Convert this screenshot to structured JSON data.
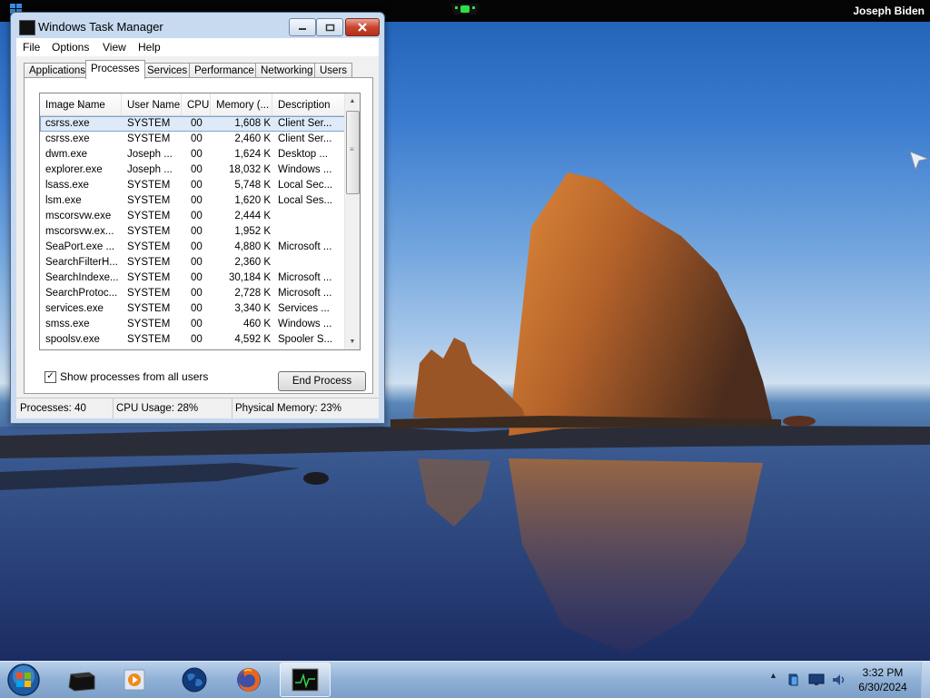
{
  "topbar": {
    "user_name": "Joseph Biden"
  },
  "window": {
    "title": "Windows Task Manager",
    "controls": {
      "minimize": "minimize-icon",
      "maximize": "maximize-icon",
      "close": "close-icon"
    }
  },
  "menu": [
    "File",
    "Options",
    "View",
    "Help"
  ],
  "tabs": [
    "Applications",
    "Processes",
    "Services",
    "Performance",
    "Networking",
    "Users"
  ],
  "active_tab": "Processes",
  "columns": [
    "Image Name",
    "User Name",
    "CPU",
    "Memory (...",
    "Description"
  ],
  "processes": [
    {
      "name": "csrss.exe",
      "user": "SYSTEM",
      "cpu": "00",
      "mem": "1,608 K",
      "desc": "Client Ser..."
    },
    {
      "name": "csrss.exe",
      "user": "SYSTEM",
      "cpu": "00",
      "mem": "2,460 K",
      "desc": "Client Ser..."
    },
    {
      "name": "dwm.exe",
      "user": "Joseph ...",
      "cpu": "00",
      "mem": "1,624 K",
      "desc": "Desktop ..."
    },
    {
      "name": "explorer.exe",
      "user": "Joseph ...",
      "cpu": "00",
      "mem": "18,032 K",
      "desc": "Windows ..."
    },
    {
      "name": "lsass.exe",
      "user": "SYSTEM",
      "cpu": "00",
      "mem": "5,748 K",
      "desc": "Local Sec..."
    },
    {
      "name": "lsm.exe",
      "user": "SYSTEM",
      "cpu": "00",
      "mem": "1,620 K",
      "desc": "Local Ses..."
    },
    {
      "name": "mscorsvw.exe",
      "user": "SYSTEM",
      "cpu": "00",
      "mem": "2,444 K",
      "desc": ""
    },
    {
      "name": "mscorsvw.ex...",
      "user": "SYSTEM",
      "cpu": "00",
      "mem": "1,952 K",
      "desc": ""
    },
    {
      "name": "SeaPort.exe ...",
      "user": "SYSTEM",
      "cpu": "00",
      "mem": "4,880 K",
      "desc": "Microsoft ..."
    },
    {
      "name": "SearchFilterH...",
      "user": "SYSTEM",
      "cpu": "00",
      "mem": "2,360 K",
      "desc": ""
    },
    {
      "name": "SearchIndexe...",
      "user": "SYSTEM",
      "cpu": "00",
      "mem": "30,184 K",
      "desc": "Microsoft ..."
    },
    {
      "name": "SearchProtoc...",
      "user": "SYSTEM",
      "cpu": "00",
      "mem": "2,728 K",
      "desc": "Microsoft ..."
    },
    {
      "name": "services.exe",
      "user": "SYSTEM",
      "cpu": "00",
      "mem": "3,340 K",
      "desc": "Services ..."
    },
    {
      "name": "smss.exe",
      "user": "SYSTEM",
      "cpu": "00",
      "mem": "460 K",
      "desc": "Windows ..."
    },
    {
      "name": "spoolsv.exe",
      "user": "SYSTEM",
      "cpu": "00",
      "mem": "4,592 K",
      "desc": "Spooler S..."
    }
  ],
  "selected_row": 0,
  "show_all_label": "Show processes from all users",
  "show_all_checked": true,
  "end_process_label": "End Process",
  "status": {
    "processes": "Processes: 40",
    "cpu": "CPU Usage: 28%",
    "memory": "Physical Memory: 23%"
  },
  "taskbar": {
    "items": [
      "start-orb-icon",
      "terminal-icon",
      "media-player-icon",
      "globe-icon",
      "firefox-icon",
      "task-manager-icon"
    ],
    "active_item": "task-manager-icon",
    "tray_icons": [
      "show-hidden-icons-icon",
      "network-device-icon",
      "monitor-icon",
      "volume-icon"
    ],
    "clock_time": "3:32 PM",
    "clock_date": "6/30/2024"
  },
  "colors": {
    "selection": "#dfeaf9",
    "selection_border": "#7da2ce",
    "titlebar": "#c8daf0",
    "close_button": "#c9452e"
  }
}
